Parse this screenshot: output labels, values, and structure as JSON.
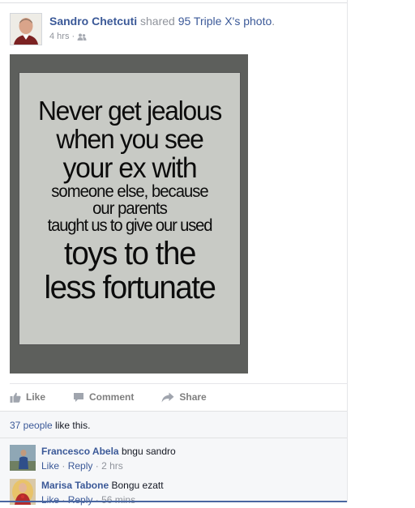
{
  "post": {
    "author": "Sandro Chetcuti",
    "shared_text": "shared",
    "source": "95 Triple X's",
    "source_object": "photo",
    "period": ".",
    "timestamp": "4 hrs",
    "separator": "·",
    "audience_icon": "friends-icon"
  },
  "photo": {
    "quote_lines": [
      "Never get jealous",
      "when you see",
      "your ex with",
      "someone else, because",
      "our parents",
      "taught us to give our used",
      "toys to the",
      "less fortunate"
    ]
  },
  "actions": {
    "like_label": "Like",
    "comment_label": "Comment",
    "share_label": "Share"
  },
  "likes": {
    "count_text": "37 people",
    "suffix": " like this."
  },
  "comments": [
    {
      "author": "Francesco Abela",
      "text": "bngu sandro",
      "like": "Like",
      "reply": "Reply",
      "sep": "·",
      "time": "2 hrs"
    },
    {
      "author": "Marisa Tabone",
      "text": "Bongu ezatt",
      "like": "Like",
      "reply": "Reply",
      "sep": "·",
      "time": "56 mins"
    }
  ],
  "colors": {
    "link": "#3b5998",
    "muted": "#90949c",
    "action": "#7f7f7f",
    "ufi_bg": "#f6f7f9"
  }
}
